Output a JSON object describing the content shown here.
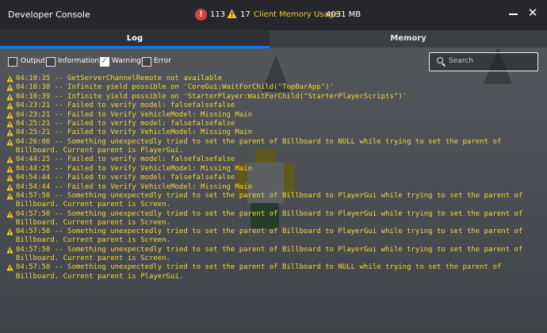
{
  "titlebar": {
    "title": "Developer Console",
    "error_count": "113",
    "warning_count": "17",
    "memory_label": "Client Memory Usage:",
    "memory_value": "4031 MB",
    "close_glyph": "✕"
  },
  "tabs": {
    "log": "Log",
    "memory": "Memory"
  },
  "filters": {
    "output": "Output",
    "information": "Information",
    "warning": "Warning",
    "error": "Error"
  },
  "search": {
    "placeholder": "Search"
  },
  "colors": {
    "warning_text": "#f4d83c",
    "accent": "#0a7bff",
    "error": "#d8413a"
  },
  "log": [
    "04:10:35 -- GetServerChannelRemote not available",
    "04:10:38 -- Infinite yield possible on 'CoreGui:WaitForChild(\"TopBarApp\")'",
    "04:10:39 -- Infinite yield possible on 'StarterPlayer:WaitForChild(\"StarterPlayerScripts\")'",
    "04:23:21 -- Failed to verify model: falsefalsefalse",
    "04:23:21 -- Failed to Verify VehicleModel: Missing Main",
    "04:25:21 -- Failed to verify model: falsefalsefalse",
    "04:25:21 -- Failed to Verify VehicleModel: Missing Main",
    "04:26:06 -- Something unexpectedly tried to set the parent of Billboard to NULL while trying to set the parent of Billboard. Current parent is PlayerGui.",
    "04:44:25 -- Failed to verify model: falsefalsefalse",
    "04:44:25 -- Failed to Verify VehicleModel: Missing Main",
    "04:54:44 -- Failed to verify model: falsefalsefalse",
    "04:54:44 -- Failed to Verify VehicleModel: Missing Main",
    "04:57:50 -- Something unexpectedly tried to set the parent of Billboard to PlayerGui while trying to set the parent of Billboard. Current parent is Screen.",
    "04:57:50 -- Something unexpectedly tried to set the parent of Billboard to PlayerGui while trying to set the parent of Billboard. Current parent is Screen.",
    "04:57:50 -- Something unexpectedly tried to set the parent of Billboard to PlayerGui while trying to set the parent of Billboard. Current parent is Screen.",
    "04:57:50 -- Something unexpectedly tried to set the parent of Billboard to PlayerGui while trying to set the parent of Billboard. Current parent is Screen.",
    "04:57:50 -- Something unexpectedly tried to set the parent of Billboard to NULL while trying to set the parent of Billboard. Current parent is PlayerGui."
  ]
}
